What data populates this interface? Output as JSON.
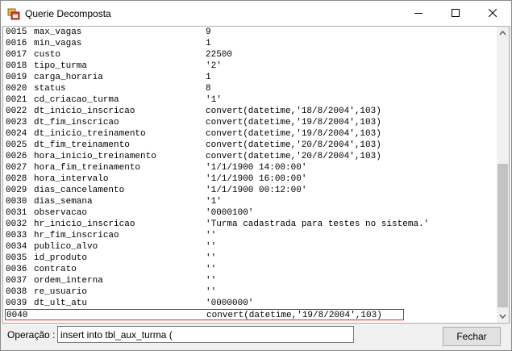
{
  "window": {
    "title": "Querie Decomposta"
  },
  "lines": [
    {
      "num": "0015",
      "name": "max_vagas",
      "value": "9"
    },
    {
      "num": "0016",
      "name": "min_vagas",
      "value": "1"
    },
    {
      "num": "0017",
      "name": "custo",
      "value": "22500"
    },
    {
      "num": "0018",
      "name": "tipo_turma",
      "value": "'2'"
    },
    {
      "num": "0019",
      "name": "carga_horaria",
      "value": "1"
    },
    {
      "num": "0020",
      "name": "status",
      "value": "8"
    },
    {
      "num": "0021",
      "name": "cd_criacao_turma",
      "value": "'1'"
    },
    {
      "num": "0022",
      "name": "dt_inicio_inscricao",
      "value": "convert(datetime,'18/8/2004',103)"
    },
    {
      "num": "0023",
      "name": "dt_fim_inscricao",
      "value": "convert(datetime,'19/8/2004',103)"
    },
    {
      "num": "0024",
      "name": "dt_inicio_treinamento",
      "value": "convert(datetime,'19/8/2004',103)"
    },
    {
      "num": "0025",
      "name": "dt_fim_treinamento",
      "value": "convert(datetime,'20/8/2004',103)"
    },
    {
      "num": "0026",
      "name": "hora_inicio_treinamento",
      "value": "convert(datetime,'20/8/2004',103)"
    },
    {
      "num": "0027",
      "name": "hora_fim_treinamento",
      "value": "'1/1/1900 14:00:00'"
    },
    {
      "num": "0028",
      "name": "hora_intervalo",
      "value": "'1/1/1900 16:00:00'"
    },
    {
      "num": "0029",
      "name": "dias_cancelamento",
      "value": "'1/1/1900 00:12:00'"
    },
    {
      "num": "0030",
      "name": "dias_semana",
      "value": "'1'"
    },
    {
      "num": "0031",
      "name": "observacao",
      "value": "'0000100'"
    },
    {
      "num": "0032",
      "name": "hr_inicio_inscricao",
      "value": "'Turma cadastrada para testes no sistema.'"
    },
    {
      "num": "0033",
      "name": "hr_fim_inscricao",
      "value": "''"
    },
    {
      "num": "0034",
      "name": "publico_alvo",
      "value": "''"
    },
    {
      "num": "0035",
      "name": "id_produto",
      "value": "''"
    },
    {
      "num": "0036",
      "name": "contrato",
      "value": "''"
    },
    {
      "num": "0037",
      "name": "ordem_interna",
      "value": "''"
    },
    {
      "num": "0038",
      "name": "re_usuario",
      "value": "''"
    },
    {
      "num": "0039",
      "name": "dt_ult_atu",
      "value": "'0000000'"
    },
    {
      "num": "0040",
      "name": "",
      "value": "convert(datetime,'19/8/2004',103)",
      "selected": true
    }
  ],
  "operation": {
    "label": "Operação :",
    "value": "insert into tbl_aux_turma ("
  },
  "close_button": {
    "label": "Fechar"
  },
  "colors": {
    "selection_border": "#e02020",
    "scroll_thumb": "#c2c2c2"
  },
  "icons": {
    "app": "app-window-icon",
    "minimize": "minimize-icon",
    "maximize": "maximize-icon",
    "close": "close-icon"
  }
}
